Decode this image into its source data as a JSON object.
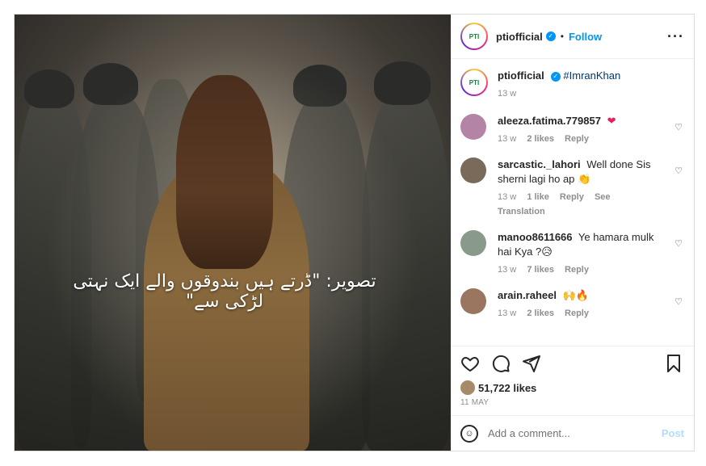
{
  "post": {
    "image_overlay_text": "تصویر: \"ڈرتے ہیں بندوقوں والے ایک نہتی لڑکی سے\"",
    "header": {
      "username": "ptiofficial",
      "separator": "•",
      "follow_label": "Follow",
      "more_icon": "more-horizontal-icon"
    },
    "caption": {
      "username": "ptiofficial",
      "text": "#ImranKhan",
      "time": "13 w"
    },
    "comments": [
      {
        "user": "aleeza.fatima.779857",
        "text": "❤",
        "time": "13 w",
        "likes": "2 likes",
        "reply": "Reply",
        "extra": "",
        "avatar_color": "#b483a5"
      },
      {
        "user": "sarcastic._lahori",
        "text": "Well done Sis sherni lagi ho ap 👏",
        "time": "13 w",
        "likes": "1 like",
        "reply": "Reply",
        "extra": "See Translation",
        "avatar_color": "#7a6a5a"
      },
      {
        "user": "manoo8611666",
        "text": "Ye hamara mulk hai Kya ?😥",
        "time": "13 w",
        "likes": "7 likes",
        "reply": "Reply",
        "extra": "",
        "avatar_color": "#8a9a8a"
      },
      {
        "user": "arain.raheel",
        "text": "🙌🔥",
        "time": "13 w",
        "likes": "2 likes",
        "reply": "Reply",
        "extra": "",
        "avatar_color": "#9a7560"
      }
    ],
    "likes_count": "51,722 likes",
    "date": "11 MAY",
    "add_comment_placeholder": "Add a comment...",
    "post_label": "Post",
    "action_icons": [
      "heart-icon",
      "comment-icon",
      "share-icon",
      "bookmark-icon"
    ]
  }
}
